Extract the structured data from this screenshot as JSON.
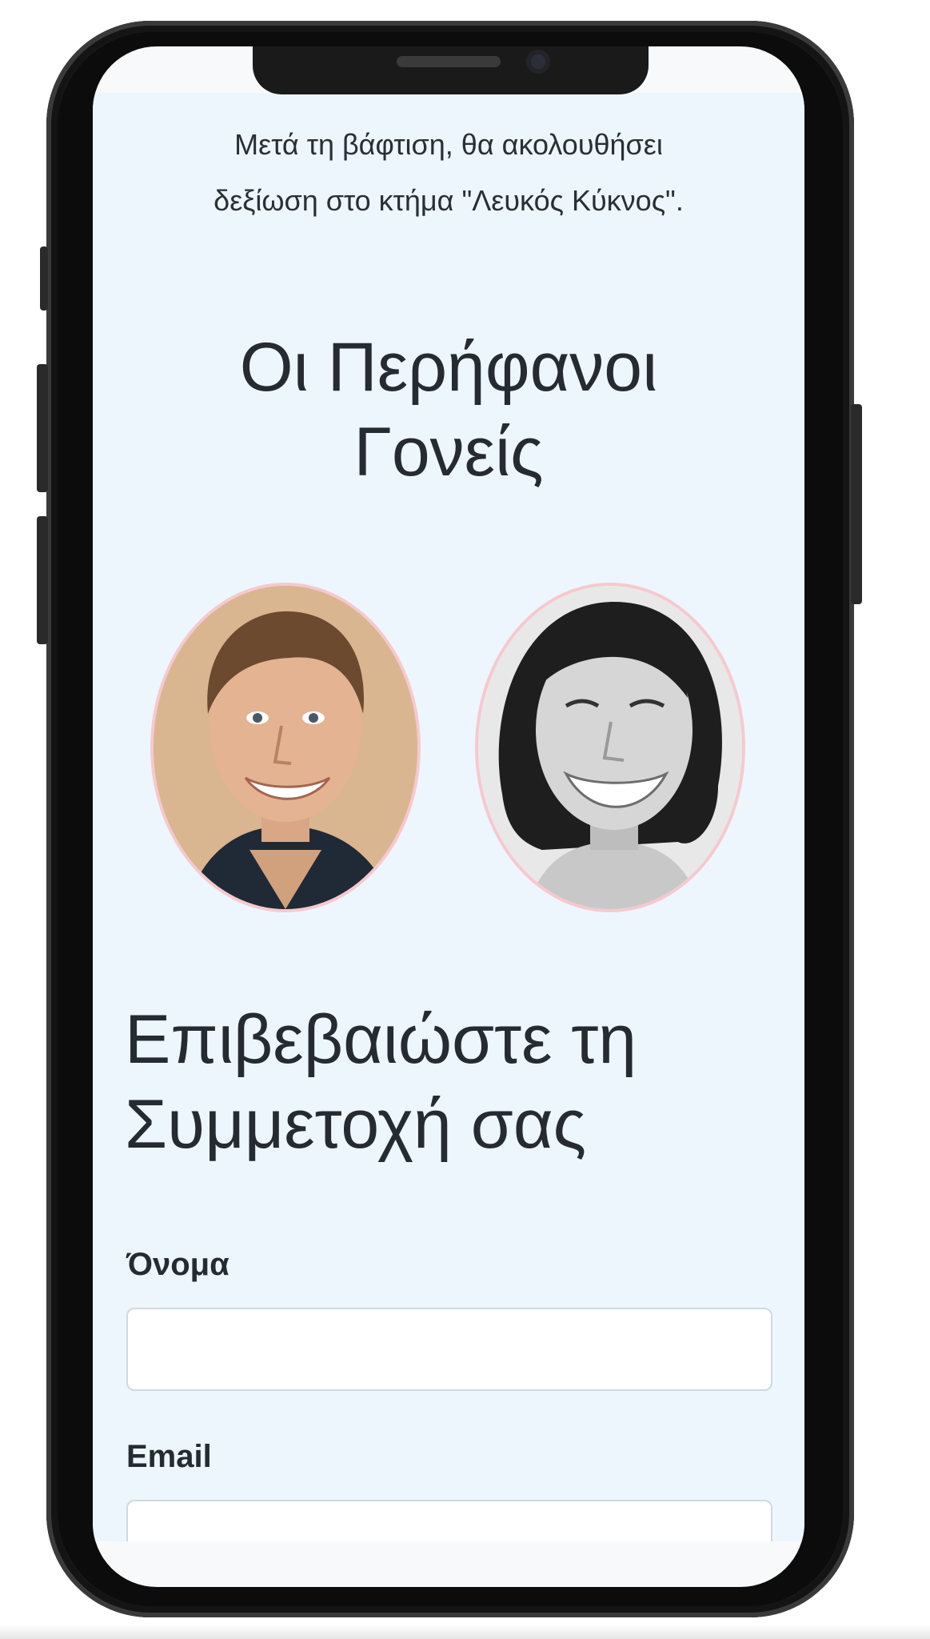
{
  "invite": {
    "intro_line1": "Μετά τη βάφτιση, θα ακολουθήσει",
    "intro_line2": "δεξίωση στο κτήμα \"Λευκός Κύκνος\"."
  },
  "parents": {
    "title_line1": "Οι Περήφανοι",
    "title_line2": "Γονείς"
  },
  "rsvp": {
    "title_line1": "Επιβεβαιώστε τη",
    "title_line2": "Συμμετοχή σας",
    "name_label": "Όνομα",
    "name_value": "",
    "email_label": "Email",
    "email_value": ""
  },
  "colors": {
    "page_background": "#eef6fd",
    "portrait_border": "#f6c9cf",
    "text": "#262b33"
  }
}
